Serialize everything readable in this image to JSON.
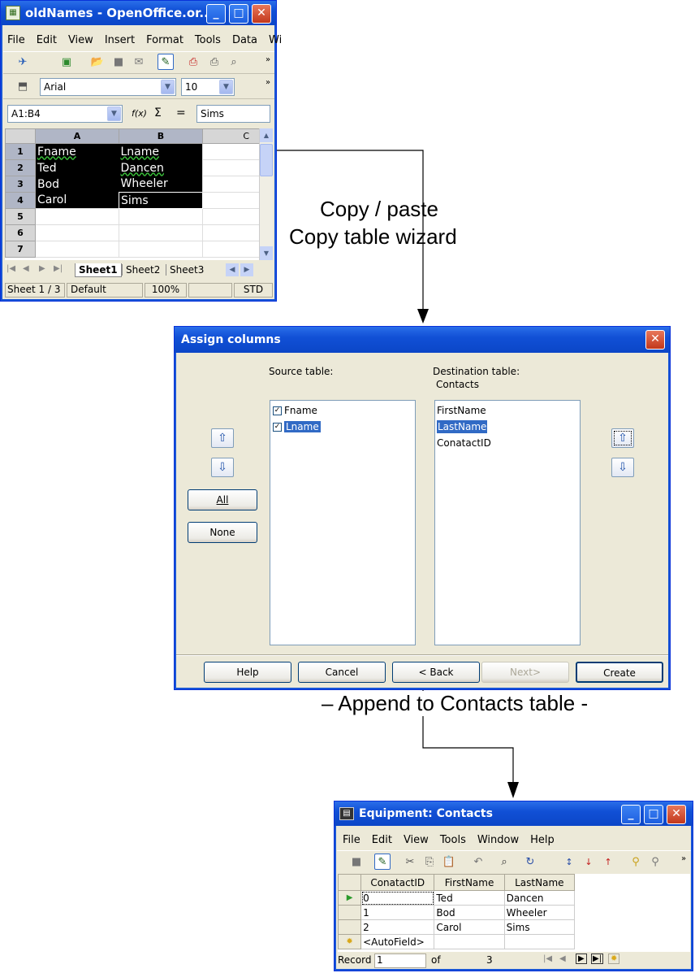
{
  "spreadsheet": {
    "title": "oldNames - OpenOffice.or...",
    "menu": [
      "File",
      "Edit",
      "View",
      "Insert",
      "Format",
      "Tools",
      "Data",
      "Wi"
    ],
    "font_name": "Arial",
    "font_size": "10",
    "name_box": "A1:B4",
    "fx_symbol": "f(x)",
    "sum_symbol": "Σ",
    "eq_symbol": "=",
    "formula_value": "Sims",
    "col_headers": [
      "A",
      "B",
      "C"
    ],
    "rows": [
      {
        "num": "1",
        "a": "Fname",
        "b": "Lname"
      },
      {
        "num": "2",
        "a": "Ted",
        "b": "Dancen"
      },
      {
        "num": "3",
        "a": "Bod",
        "b": "Wheeler"
      },
      {
        "num": "4",
        "a": "Carol",
        "b": "Sims"
      },
      {
        "num": "5",
        "a": "",
        "b": ""
      },
      {
        "num": "6",
        "a": "",
        "b": ""
      },
      {
        "num": "7",
        "a": "",
        "b": ""
      }
    ],
    "sheet_tabs": [
      "Sheet1",
      "Sheet2",
      "Sheet3"
    ],
    "status": {
      "sheet": "Sheet 1 / 3",
      "style": "Default",
      "zoom": "100%",
      "mode": "STD"
    }
  },
  "annotations": {
    "copy_paste": "Copy / paste",
    "wizard": "Copy table wizard",
    "append": "– Append to Contacts table -"
  },
  "dialog": {
    "title": "Assign columns",
    "source_label": "Source table:",
    "dest_label": "Destination table:",
    "dest_name": "Contacts",
    "source_items": [
      {
        "label": "Fname",
        "checked": true
      },
      {
        "label": "Lname",
        "checked": true
      }
    ],
    "dest_items": [
      "FirstName",
      "LastName",
      "ConatactID"
    ],
    "all_button": "All",
    "none_button": "None",
    "buttons": {
      "help": "Help",
      "cancel": "Cancel",
      "back": "< Back",
      "next": "Next>",
      "create": "Create"
    }
  },
  "base": {
    "title": "Equipment: Contacts",
    "menu": [
      "File",
      "Edit",
      "View",
      "Tools",
      "Window",
      "Help"
    ],
    "columns": [
      "ConatactID",
      "FirstName",
      "LastName"
    ],
    "rows": [
      {
        "id": "0",
        "first": "Ted",
        "last": "Dancen"
      },
      {
        "id": "1",
        "first": "Bod",
        "last": "Wheeler"
      },
      {
        "id": "2",
        "first": "Carol",
        "last": "Sims"
      }
    ],
    "new_row": "<AutoField>",
    "record_label": "Record",
    "record_value": "1",
    "of_label": "of",
    "record_count": "3"
  }
}
